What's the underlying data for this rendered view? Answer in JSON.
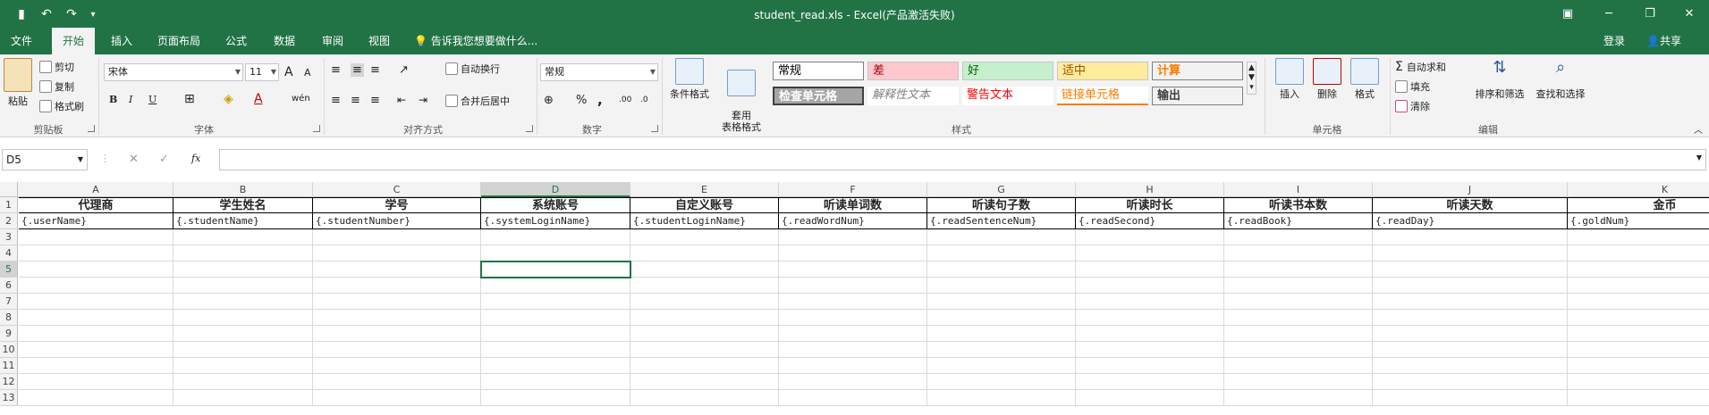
{
  "window": {
    "title": "student_read.xls - Excel(产品激活失败)",
    "min_glyph": "─",
    "max_glyph": "❐",
    "close_glyph": "✕",
    "ribbon_opt_glyph": "▣"
  },
  "qat": {
    "save_glyph": "▮",
    "undo_glyph": "↶",
    "redo_glyph": "↷",
    "more_glyph": "▾"
  },
  "tabs": [
    "文件",
    "开始",
    "插入",
    "页面布局",
    "公式",
    "数据",
    "审阅",
    "视图"
  ],
  "tell_me": "告诉我您想要做什么...",
  "account": {
    "login": "登录",
    "share": "共享"
  },
  "ribbon": {
    "clipboard": {
      "label": "剪贴板",
      "paste": "粘贴",
      "cut": "剪切",
      "copy": "复制",
      "format_painter": "格式刷"
    },
    "font": {
      "label": "字体",
      "font_name": "宋体",
      "font_size": "11",
      "grow": "A",
      "shrink": "A",
      "bold": "B",
      "italic": "I",
      "underline": "U",
      "border": "⊞",
      "fill": "◈",
      "color": "A",
      "phonetic": "wén"
    },
    "alignment": {
      "label": "对齐方式",
      "wrap": "自动换行",
      "merge": "合并后居中"
    },
    "number": {
      "label": "数字",
      "format": "常规",
      "currency": "⊕",
      "percent": "%",
      "comma": ",",
      "inc": ".00",
      "dec": ".0"
    },
    "styles": {
      "label": "样式",
      "conditional": "条件格式",
      "table": "套用\n表格格式",
      "cells": [
        {
          "text": "常规",
          "bg": "#ffffff",
          "fg": "#000000"
        },
        {
          "text": "差",
          "bg": "#ffc7ce",
          "fg": "#9c0006"
        },
        {
          "text": "好",
          "bg": "#c6efce",
          "fg": "#006100"
        },
        {
          "text": "适中",
          "bg": "#ffeb9c",
          "fg": "#9c5700"
        },
        {
          "text": "计算",
          "bg": "#f2f2f2",
          "fg": "#fa7d00"
        },
        {
          "text": "检查单元格",
          "bg": "#a5a5a5",
          "fg": "#ffffff"
        },
        {
          "text": "解释性文本",
          "bg": "#ffffff",
          "fg": "#7f7f7f"
        },
        {
          "text": "警告文本",
          "bg": "#ffffff",
          "fg": "#ff0000"
        },
        {
          "text": "链接单元格",
          "bg": "#ffffff",
          "fg": "#fa7d00"
        },
        {
          "text": "输出",
          "bg": "#f2f2f2",
          "fg": "#3f3f3f"
        }
      ]
    },
    "cells_group": {
      "label": "单元格",
      "insert": "插入",
      "delete": "删除",
      "format": "格式"
    },
    "editing": {
      "label": "编辑",
      "autosum": "自动求和",
      "fill": "填充",
      "clear": "清除",
      "sort": "排序和筛选",
      "find": "查找和选择"
    }
  },
  "formula_bar": {
    "name_box": "D5",
    "cancel": "✕",
    "enter": "✓",
    "fx": "fx",
    "value": ""
  },
  "sheet": {
    "columns": [
      "A",
      "B",
      "C",
      "D",
      "E",
      "F",
      "G",
      "H",
      "I",
      "J",
      "K"
    ],
    "selected_column": "D",
    "rows": [
      "1",
      "2",
      "3",
      "4",
      "5",
      "6",
      "7",
      "8",
      "9",
      "10",
      "11",
      "12",
      "13"
    ],
    "selected_row": "5",
    "header_row": [
      "代理商",
      "学生姓名",
      "学号",
      "系统账号",
      "自定义账号",
      "听读单词数",
      "听读句子数",
      "听读时长",
      "听读书本数",
      "听读天数",
      "金币"
    ],
    "template_row": [
      "{.userName}",
      "{.studentName}",
      "{.studentNumber}",
      "{.systemLoginName}",
      "{.studentLoginName}",
      "{.readWordNum}",
      "{.readSentenceNum}",
      "{.readSecond}",
      "{.readBook}",
      "{.readDay}",
      "{.goldNum}"
    ]
  },
  "colors": {
    "accent": "#217346",
    "ribbon_bg": "#f3f3f3"
  }
}
